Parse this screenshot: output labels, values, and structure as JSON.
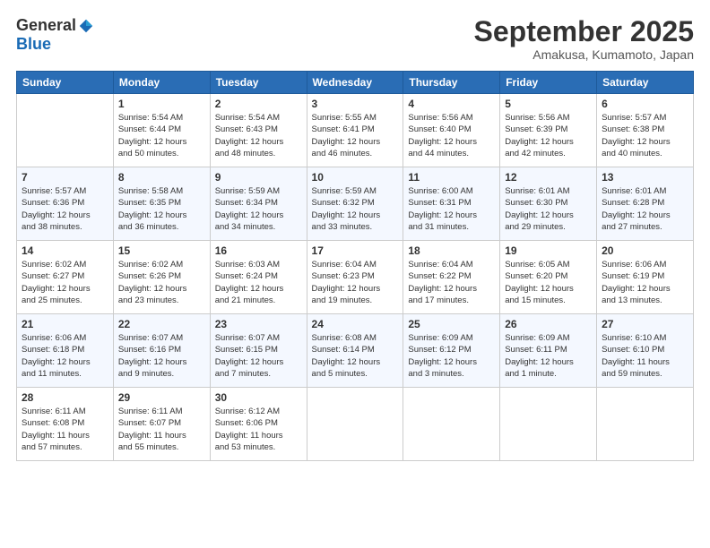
{
  "logo": {
    "general": "General",
    "blue": "Blue"
  },
  "title": "September 2025",
  "subtitle": "Amakusa, Kumamoto, Japan",
  "headers": [
    "Sunday",
    "Monday",
    "Tuesday",
    "Wednesday",
    "Thursday",
    "Friday",
    "Saturday"
  ],
  "weeks": [
    [
      {
        "day": "",
        "info": ""
      },
      {
        "day": "1",
        "info": "Sunrise: 5:54 AM\nSunset: 6:44 PM\nDaylight: 12 hours\nand 50 minutes."
      },
      {
        "day": "2",
        "info": "Sunrise: 5:54 AM\nSunset: 6:43 PM\nDaylight: 12 hours\nand 48 minutes."
      },
      {
        "day": "3",
        "info": "Sunrise: 5:55 AM\nSunset: 6:41 PM\nDaylight: 12 hours\nand 46 minutes."
      },
      {
        "day": "4",
        "info": "Sunrise: 5:56 AM\nSunset: 6:40 PM\nDaylight: 12 hours\nand 44 minutes."
      },
      {
        "day": "5",
        "info": "Sunrise: 5:56 AM\nSunset: 6:39 PM\nDaylight: 12 hours\nand 42 minutes."
      },
      {
        "day": "6",
        "info": "Sunrise: 5:57 AM\nSunset: 6:38 PM\nDaylight: 12 hours\nand 40 minutes."
      }
    ],
    [
      {
        "day": "7",
        "info": "Sunrise: 5:57 AM\nSunset: 6:36 PM\nDaylight: 12 hours\nand 38 minutes."
      },
      {
        "day": "8",
        "info": "Sunrise: 5:58 AM\nSunset: 6:35 PM\nDaylight: 12 hours\nand 36 minutes."
      },
      {
        "day": "9",
        "info": "Sunrise: 5:59 AM\nSunset: 6:34 PM\nDaylight: 12 hours\nand 34 minutes."
      },
      {
        "day": "10",
        "info": "Sunrise: 5:59 AM\nSunset: 6:32 PM\nDaylight: 12 hours\nand 33 minutes."
      },
      {
        "day": "11",
        "info": "Sunrise: 6:00 AM\nSunset: 6:31 PM\nDaylight: 12 hours\nand 31 minutes."
      },
      {
        "day": "12",
        "info": "Sunrise: 6:01 AM\nSunset: 6:30 PM\nDaylight: 12 hours\nand 29 minutes."
      },
      {
        "day": "13",
        "info": "Sunrise: 6:01 AM\nSunset: 6:28 PM\nDaylight: 12 hours\nand 27 minutes."
      }
    ],
    [
      {
        "day": "14",
        "info": "Sunrise: 6:02 AM\nSunset: 6:27 PM\nDaylight: 12 hours\nand 25 minutes."
      },
      {
        "day": "15",
        "info": "Sunrise: 6:02 AM\nSunset: 6:26 PM\nDaylight: 12 hours\nand 23 minutes."
      },
      {
        "day": "16",
        "info": "Sunrise: 6:03 AM\nSunset: 6:24 PM\nDaylight: 12 hours\nand 21 minutes."
      },
      {
        "day": "17",
        "info": "Sunrise: 6:04 AM\nSunset: 6:23 PM\nDaylight: 12 hours\nand 19 minutes."
      },
      {
        "day": "18",
        "info": "Sunrise: 6:04 AM\nSunset: 6:22 PM\nDaylight: 12 hours\nand 17 minutes."
      },
      {
        "day": "19",
        "info": "Sunrise: 6:05 AM\nSunset: 6:20 PM\nDaylight: 12 hours\nand 15 minutes."
      },
      {
        "day": "20",
        "info": "Sunrise: 6:06 AM\nSunset: 6:19 PM\nDaylight: 12 hours\nand 13 minutes."
      }
    ],
    [
      {
        "day": "21",
        "info": "Sunrise: 6:06 AM\nSunset: 6:18 PM\nDaylight: 12 hours\nand 11 minutes."
      },
      {
        "day": "22",
        "info": "Sunrise: 6:07 AM\nSunset: 6:16 PM\nDaylight: 12 hours\nand 9 minutes."
      },
      {
        "day": "23",
        "info": "Sunrise: 6:07 AM\nSunset: 6:15 PM\nDaylight: 12 hours\nand 7 minutes."
      },
      {
        "day": "24",
        "info": "Sunrise: 6:08 AM\nSunset: 6:14 PM\nDaylight: 12 hours\nand 5 minutes."
      },
      {
        "day": "25",
        "info": "Sunrise: 6:09 AM\nSunset: 6:12 PM\nDaylight: 12 hours\nand 3 minutes."
      },
      {
        "day": "26",
        "info": "Sunrise: 6:09 AM\nSunset: 6:11 PM\nDaylight: 12 hours\nand 1 minute."
      },
      {
        "day": "27",
        "info": "Sunrise: 6:10 AM\nSunset: 6:10 PM\nDaylight: 11 hours\nand 59 minutes."
      }
    ],
    [
      {
        "day": "28",
        "info": "Sunrise: 6:11 AM\nSunset: 6:08 PM\nDaylight: 11 hours\nand 57 minutes."
      },
      {
        "day": "29",
        "info": "Sunrise: 6:11 AM\nSunset: 6:07 PM\nDaylight: 11 hours\nand 55 minutes."
      },
      {
        "day": "30",
        "info": "Sunrise: 6:12 AM\nSunset: 6:06 PM\nDaylight: 11 hours\nand 53 minutes."
      },
      {
        "day": "",
        "info": ""
      },
      {
        "day": "",
        "info": ""
      },
      {
        "day": "",
        "info": ""
      },
      {
        "day": "",
        "info": ""
      }
    ]
  ]
}
